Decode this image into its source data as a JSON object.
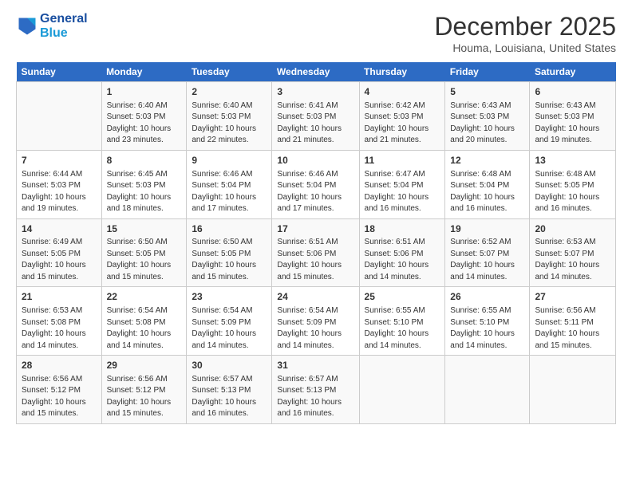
{
  "logo": {
    "line1": "General",
    "line2": "Blue"
  },
  "title": "December 2025",
  "location": "Houma, Louisiana, United States",
  "header_days": [
    "Sunday",
    "Monday",
    "Tuesday",
    "Wednesday",
    "Thursday",
    "Friday",
    "Saturday"
  ],
  "weeks": [
    [
      {
        "day": "",
        "info": ""
      },
      {
        "day": "1",
        "info": "Sunrise: 6:40 AM\nSunset: 5:03 PM\nDaylight: 10 hours\nand 23 minutes."
      },
      {
        "day": "2",
        "info": "Sunrise: 6:40 AM\nSunset: 5:03 PM\nDaylight: 10 hours\nand 22 minutes."
      },
      {
        "day": "3",
        "info": "Sunrise: 6:41 AM\nSunset: 5:03 PM\nDaylight: 10 hours\nand 21 minutes."
      },
      {
        "day": "4",
        "info": "Sunrise: 6:42 AM\nSunset: 5:03 PM\nDaylight: 10 hours\nand 21 minutes."
      },
      {
        "day": "5",
        "info": "Sunrise: 6:43 AM\nSunset: 5:03 PM\nDaylight: 10 hours\nand 20 minutes."
      },
      {
        "day": "6",
        "info": "Sunrise: 6:43 AM\nSunset: 5:03 PM\nDaylight: 10 hours\nand 19 minutes."
      }
    ],
    [
      {
        "day": "7",
        "info": "Sunrise: 6:44 AM\nSunset: 5:03 PM\nDaylight: 10 hours\nand 19 minutes."
      },
      {
        "day": "8",
        "info": "Sunrise: 6:45 AM\nSunset: 5:03 PM\nDaylight: 10 hours\nand 18 minutes."
      },
      {
        "day": "9",
        "info": "Sunrise: 6:46 AM\nSunset: 5:04 PM\nDaylight: 10 hours\nand 17 minutes."
      },
      {
        "day": "10",
        "info": "Sunrise: 6:46 AM\nSunset: 5:04 PM\nDaylight: 10 hours\nand 17 minutes."
      },
      {
        "day": "11",
        "info": "Sunrise: 6:47 AM\nSunset: 5:04 PM\nDaylight: 10 hours\nand 16 minutes."
      },
      {
        "day": "12",
        "info": "Sunrise: 6:48 AM\nSunset: 5:04 PM\nDaylight: 10 hours\nand 16 minutes."
      },
      {
        "day": "13",
        "info": "Sunrise: 6:48 AM\nSunset: 5:05 PM\nDaylight: 10 hours\nand 16 minutes."
      }
    ],
    [
      {
        "day": "14",
        "info": "Sunrise: 6:49 AM\nSunset: 5:05 PM\nDaylight: 10 hours\nand 15 minutes."
      },
      {
        "day": "15",
        "info": "Sunrise: 6:50 AM\nSunset: 5:05 PM\nDaylight: 10 hours\nand 15 minutes."
      },
      {
        "day": "16",
        "info": "Sunrise: 6:50 AM\nSunset: 5:05 PM\nDaylight: 10 hours\nand 15 minutes."
      },
      {
        "day": "17",
        "info": "Sunrise: 6:51 AM\nSunset: 5:06 PM\nDaylight: 10 hours\nand 15 minutes."
      },
      {
        "day": "18",
        "info": "Sunrise: 6:51 AM\nSunset: 5:06 PM\nDaylight: 10 hours\nand 14 minutes."
      },
      {
        "day": "19",
        "info": "Sunrise: 6:52 AM\nSunset: 5:07 PM\nDaylight: 10 hours\nand 14 minutes."
      },
      {
        "day": "20",
        "info": "Sunrise: 6:53 AM\nSunset: 5:07 PM\nDaylight: 10 hours\nand 14 minutes."
      }
    ],
    [
      {
        "day": "21",
        "info": "Sunrise: 6:53 AM\nSunset: 5:08 PM\nDaylight: 10 hours\nand 14 minutes."
      },
      {
        "day": "22",
        "info": "Sunrise: 6:54 AM\nSunset: 5:08 PM\nDaylight: 10 hours\nand 14 minutes."
      },
      {
        "day": "23",
        "info": "Sunrise: 6:54 AM\nSunset: 5:09 PM\nDaylight: 10 hours\nand 14 minutes."
      },
      {
        "day": "24",
        "info": "Sunrise: 6:54 AM\nSunset: 5:09 PM\nDaylight: 10 hours\nand 14 minutes."
      },
      {
        "day": "25",
        "info": "Sunrise: 6:55 AM\nSunset: 5:10 PM\nDaylight: 10 hours\nand 14 minutes."
      },
      {
        "day": "26",
        "info": "Sunrise: 6:55 AM\nSunset: 5:10 PM\nDaylight: 10 hours\nand 14 minutes."
      },
      {
        "day": "27",
        "info": "Sunrise: 6:56 AM\nSunset: 5:11 PM\nDaylight: 10 hours\nand 15 minutes."
      }
    ],
    [
      {
        "day": "28",
        "info": "Sunrise: 6:56 AM\nSunset: 5:12 PM\nDaylight: 10 hours\nand 15 minutes."
      },
      {
        "day": "29",
        "info": "Sunrise: 6:56 AM\nSunset: 5:12 PM\nDaylight: 10 hours\nand 15 minutes."
      },
      {
        "day": "30",
        "info": "Sunrise: 6:57 AM\nSunset: 5:13 PM\nDaylight: 10 hours\nand 16 minutes."
      },
      {
        "day": "31",
        "info": "Sunrise: 6:57 AM\nSunset: 5:13 PM\nDaylight: 10 hours\nand 16 minutes."
      },
      {
        "day": "",
        "info": ""
      },
      {
        "day": "",
        "info": ""
      },
      {
        "day": "",
        "info": ""
      }
    ]
  ]
}
